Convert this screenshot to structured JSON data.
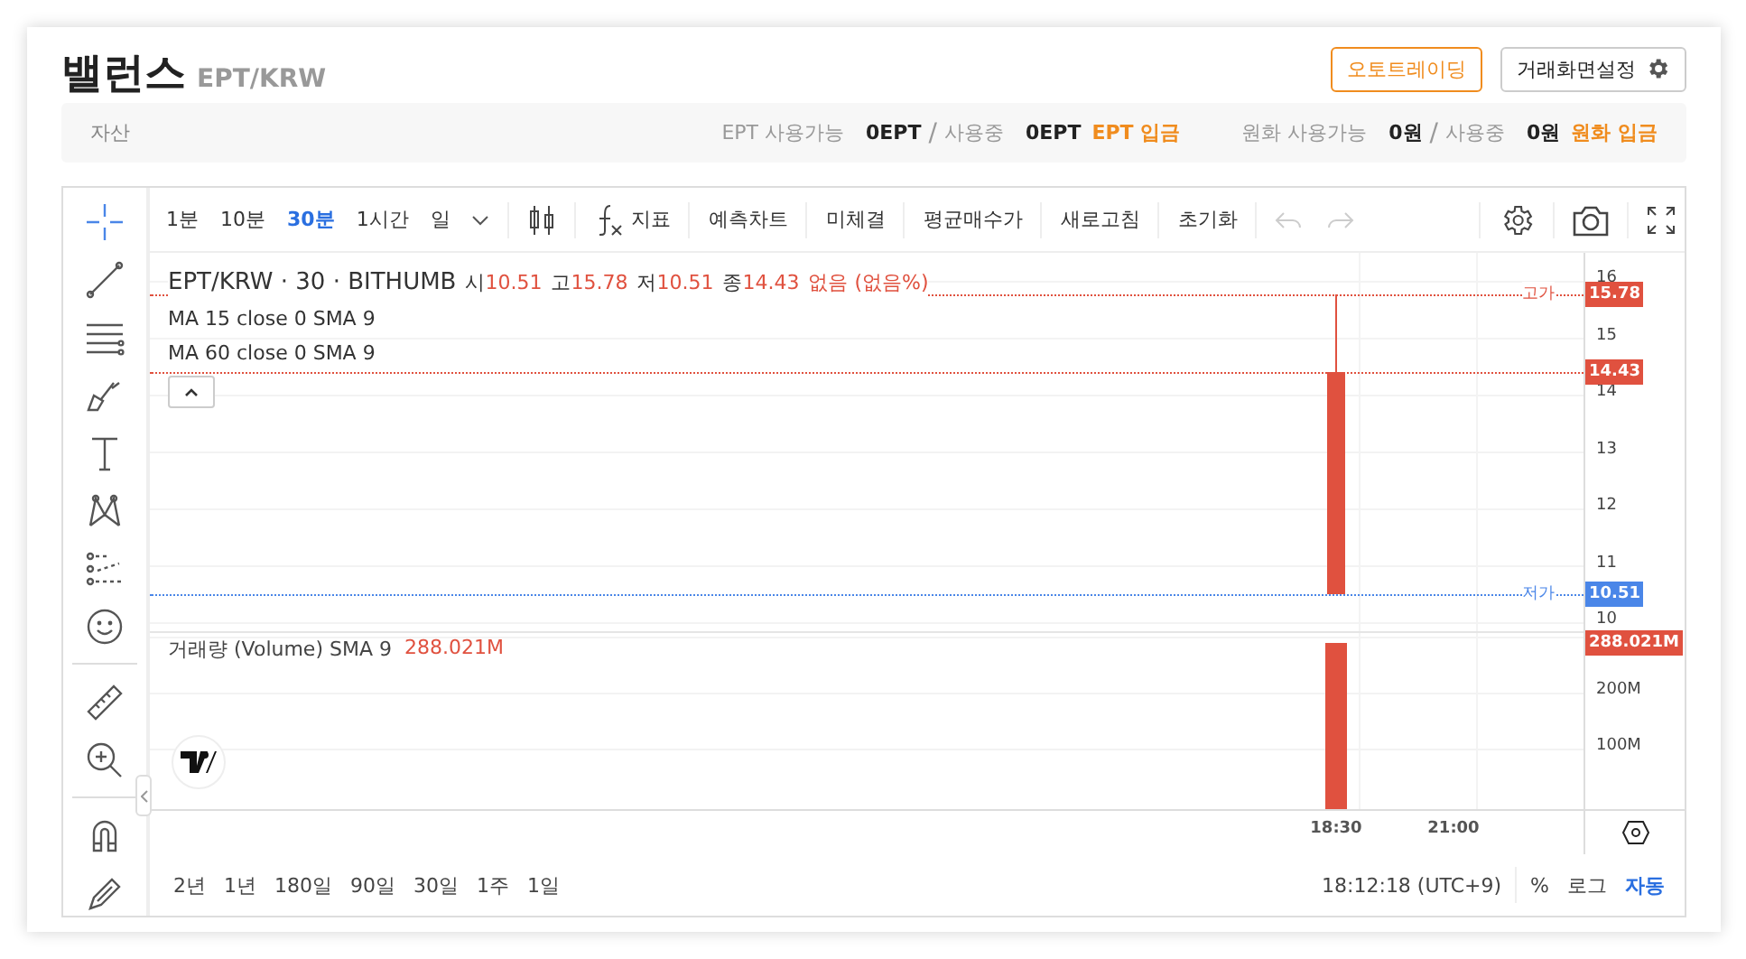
{
  "header": {
    "title": "밸런스",
    "pair": "EPT/KRW",
    "buttons": [
      {
        "label": "오토트레이딩",
        "kind": "accent"
      },
      {
        "label": "거래화면설정",
        "kind": "settings"
      }
    ]
  },
  "assets": {
    "label": "자산",
    "groups": [
      {
        "label": "EPT 사용가능",
        "available": "0EPT",
        "separator": "/",
        "in_use_label": "사용중",
        "in_use": "0EPT",
        "action": "EPT 입금"
      },
      {
        "label": "원화 사용가능",
        "available": "0원",
        "separator": "/",
        "in_use_label": "사용중",
        "in_use": "0원",
        "action": "원화 입금"
      }
    ]
  },
  "toolbar": {
    "intervals": [
      {
        "label": "1분",
        "selected": false
      },
      {
        "label": "10분",
        "selected": false
      },
      {
        "label": "30분",
        "selected": true
      },
      {
        "label": "1시간",
        "selected": false
      },
      {
        "label": "일",
        "selected": false
      }
    ],
    "indicator": "지표",
    "buttons": [
      "예측차트",
      "미체결",
      "평균매수가",
      "새로고침",
      "초기화"
    ]
  },
  "tools": [
    {
      "selected": true
    },
    {
      "selected": false
    },
    {
      "selected": false
    },
    {
      "selected": false
    },
    {
      "selected": false
    },
    {
      "selected": false
    },
    {
      "selected": false
    },
    {
      "selected": false
    },
    {
      "selected": false
    },
    {
      "selected": false
    },
    {
      "selected": false
    },
    {
      "selected": false
    }
  ],
  "chart": {
    "symbol": "EPT/KRW · 30 · BITHUMB",
    "ohlc": [
      {
        "label": "시",
        "value": "10.51"
      },
      {
        "label": "고",
        "value": "15.78"
      },
      {
        "label": "저",
        "value": "10.51"
      },
      {
        "label": "종",
        "value": "14.43"
      }
    ],
    "change": "없음 (없음%)",
    "studies": [
      "MA 15 close 0 SMA 9",
      "MA 60 close 0 SMA 9"
    ],
    "price_ticks": [
      "16",
      "15",
      "14",
      "13",
      "12",
      "11",
      "10"
    ],
    "price_tags": [
      {
        "label": "고가",
        "value": "15.78",
        "color": "#e0513f"
      },
      {
        "value": "14.43",
        "color": "#e0513f"
      },
      {
        "label": "저가",
        "value": "10.51",
        "color": "#4a86e8"
      }
    ],
    "volume_legend": "거래량 (Volume) SMA 9",
    "volume_value": "288.021M",
    "volume_tag": {
      "value": "288.021M",
      "color": "#e0513f"
    },
    "volume_ticks": [
      "200M",
      "100M"
    ],
    "time_ticks": [
      "18:30",
      "21:00"
    ]
  },
  "bottom": {
    "ranges": [
      "2년",
      "1년",
      "180일",
      "90일",
      "30일",
      "1주",
      "1일"
    ],
    "clock": "18:12:18 (UTC+9)",
    "scale_options": [
      {
        "label": "%",
        "selected": false
      },
      {
        "label": "로그",
        "selected": false
      },
      {
        "label": "자동",
        "selected": true
      }
    ]
  }
}
